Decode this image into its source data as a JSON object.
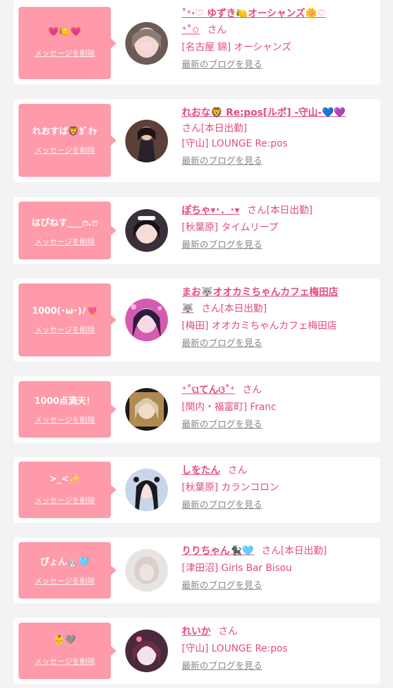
{
  "colors": {
    "bubble": "#ff9aaa",
    "accent": "#e24c7a",
    "link_gray": "#888888",
    "background": "#f3f3f3"
  },
  "cards": [
    {
      "message": "💗🍋💗",
      "delete_label": "メッセージを削除",
      "name": "˚⁺‧♡ ゆずき🍋オーシャンズ🌼♡",
      "name_cont": "⁺˚✩",
      "suffix": "さん",
      "shop": "[名古屋 錦] オーシャンズ",
      "blog_label": "最新のブログを見る"
    },
    {
      "message": "れおすば🦁ｶﾞｵｯ",
      "delete_label": "メッセージを削除",
      "name": "れおな🦁 Re:pos[ルポ] -守山-💙💜",
      "name_cont": "",
      "suffix": "さん[本日出勤]",
      "shop": "[守山] LOUNGE Re:pos",
      "blog_label": "最新のブログを見る"
    },
    {
      "message": "はぴねす‿‿ෆ.ෆ",
      "delete_label": "メッセージを削除",
      "name": "ぽちゃ▾･．･▾",
      "name_cont": "",
      "suffix": "さん[本日出勤]",
      "shop": "[秋葉原] タイムリープ",
      "blog_label": "最新のブログを見る"
    },
    {
      "message": "1000(･ω･)ﾉ💘",
      "delete_label": "メッセージを削除",
      "name": "まお🐺オオカミちゃんカフェ梅田店",
      "name_cont": "🐺",
      "suffix": "さん[本日出勤]",
      "shop": "[梅田] オオカミちゃんカフェ梅田店",
      "blog_label": "最新のブログを見る"
    },
    {
      "message": "1000点満天！",
      "delete_label": "メッセージを削除",
      "name": "⁺˚ଘてんଓ˚⁺",
      "name_cont": "",
      "suffix": "さん",
      "shop": "[関内・福富町] Franc",
      "blog_label": "最新のブログを見る"
    },
    {
      "message": ">_<✨",
      "delete_label": "メッセージを削除",
      "name": "しをたん",
      "name_cont": "",
      "suffix": "さん",
      "shop": "[秋葉原] カランコロン",
      "blog_label": "最新のブログを見る"
    },
    {
      "message": "ぴょん🐰🩵",
      "delete_label": "メッセージを削除",
      "name": "りりちゃん🐈‍⬛🩵",
      "name_cont": "",
      "suffix": "さん[本日出勤]",
      "shop": "[津田沼] Girls Bar Bisou",
      "blog_label": "最新のブログを見る"
    },
    {
      "message": "👶🩶",
      "delete_label": "メッセージを削除",
      "name": "れいか",
      "name_cont": "",
      "suffix": "さん",
      "shop": "[守山] LOUNGE Re:pos",
      "blog_label": "最新のブログを見る"
    }
  ]
}
